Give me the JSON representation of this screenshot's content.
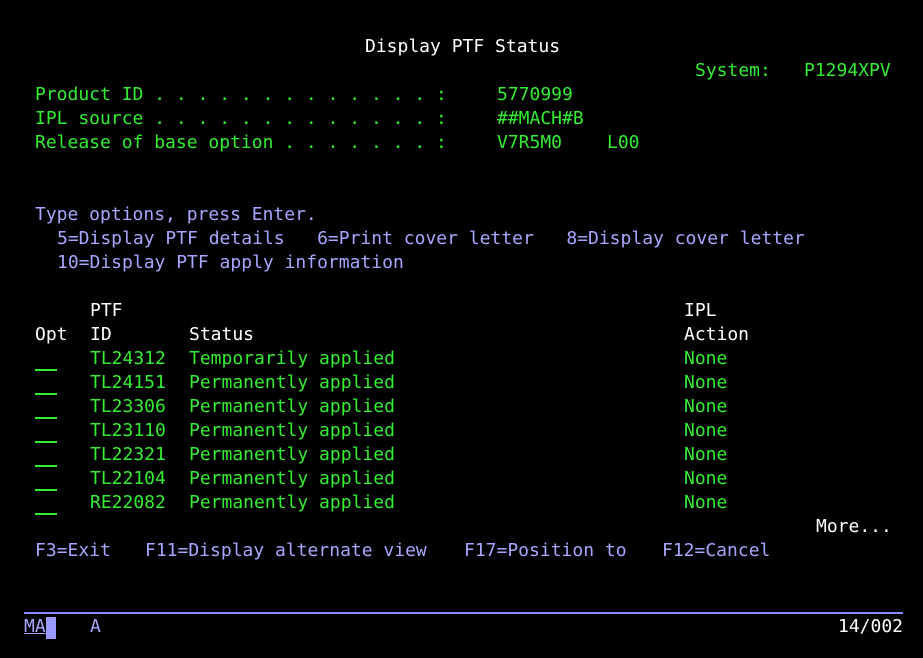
{
  "screen_title": "Display PTF Status",
  "system": {
    "label": "System:",
    "value": "P1294XPV"
  },
  "fields": {
    "product_id": {
      "label": "Product ID . . . . . . . . . . . . . :",
      "value": "5770999"
    },
    "ipl_source": {
      "label": "IPL source . . . . . . . . . . . . . :",
      "value": "##MACH#B"
    },
    "release": {
      "label": "Release of base option . . . . . . . :",
      "value": "V7R5M0",
      "level": "L00"
    }
  },
  "instructions": {
    "line1": "Type options, press Enter.",
    "line2": "5=Display PTF details   6=Print cover letter   8=Display cover letter",
    "line3": "10=Display PTF apply information"
  },
  "columns": {
    "opt": "Opt",
    "ptf_top": "PTF",
    "ptf_bottom": "ID",
    "status": "Status",
    "ipl_top": "IPL",
    "ipl_bottom": "Action"
  },
  "rows": [
    {
      "id": "TL24312",
      "status": "Temporarily applied",
      "action": "None"
    },
    {
      "id": "TL24151",
      "status": "Permanently applied",
      "action": "None"
    },
    {
      "id": "TL23306",
      "status": "Permanently applied",
      "action": "None"
    },
    {
      "id": "TL23110",
      "status": "Permanently applied",
      "action": "None"
    },
    {
      "id": "TL22321",
      "status": "Permanently applied",
      "action": "None"
    },
    {
      "id": "TL22104",
      "status": "Permanently applied",
      "action": "None"
    },
    {
      "id": "RE22082",
      "status": "Permanently applied",
      "action": "None"
    }
  ],
  "more_indicator": "More...",
  "function_keys": {
    "f3": "F3=Exit",
    "f11": "F11=Display alternate view",
    "f17": "F17=Position to",
    "f12": "F12=Cancel"
  },
  "status_bar": {
    "ma": "MA",
    "mode": "A",
    "cursor_position": "14/002"
  },
  "colors": {
    "background": "#000000",
    "field_text": "#33ee33",
    "info_text": "#a7a7ff",
    "title_text": "#ffffff"
  }
}
